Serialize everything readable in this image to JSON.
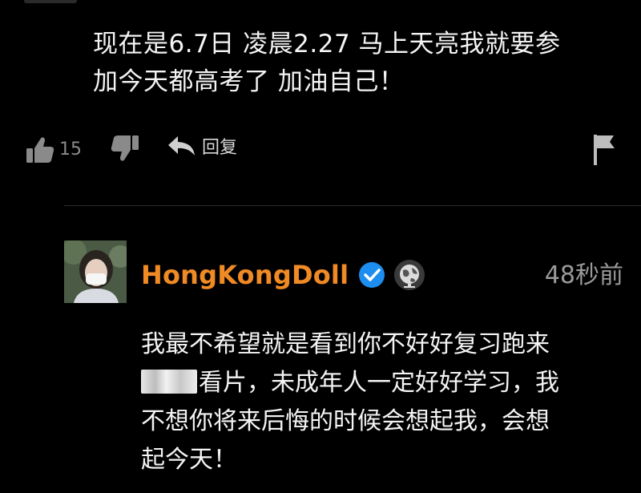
{
  "comment": {
    "lines": [
      "现在是6.7日 凌晨2.27 马上天亮我就要参",
      "加今天都高考了 加油自己！"
    ],
    "like_count": "15",
    "reply_label": "回复"
  },
  "reply": {
    "username": "HongKongDoll",
    "timestamp": "48秒前",
    "line1": "我最不希望就是看到你不好好复习跑来",
    "line2_after_blur": "看片，未成年人一定好好学习，我",
    "line3": "不想你将来后悔的时候会想起我，会想",
    "line4": "起今天！",
    "username_color": "#f08a24",
    "verified_color": "#1d8ef0"
  },
  "icons": {
    "like": "thumbs-up-icon",
    "dislike": "thumbs-down-icon",
    "reply": "reply-arrow-icon",
    "flag": "flag-icon",
    "verified": "verified-check-icon",
    "globe": "globe-icon"
  }
}
